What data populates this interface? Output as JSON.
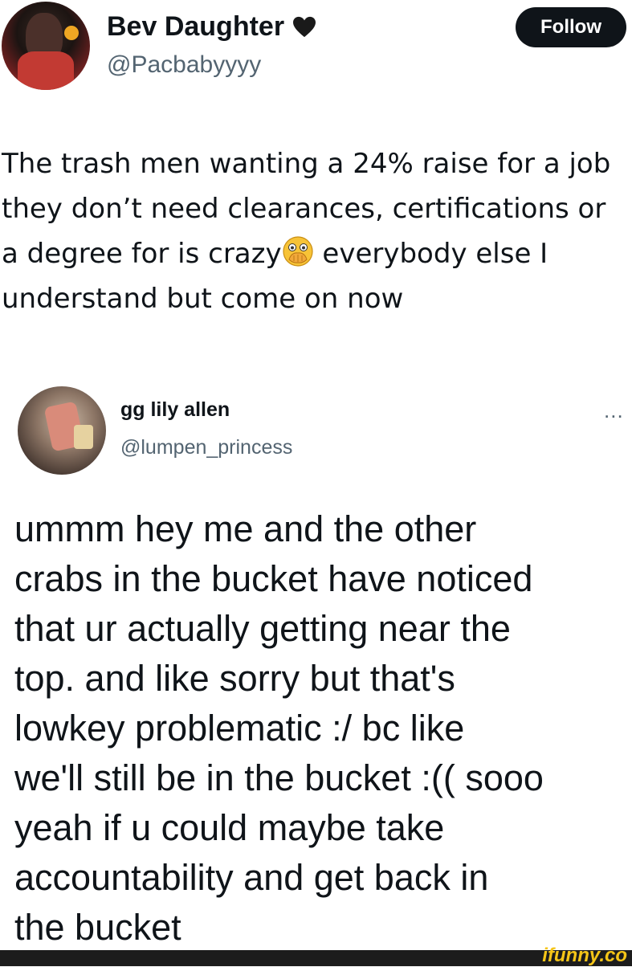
{
  "tweet1": {
    "display_name": "Bev Daughter",
    "verified_icon": "black-heart-icon",
    "handle": "@Pacbabyyyy",
    "follow_label": "Follow",
    "text_before_emoji": "The trash men wanting a 24% raise for a job they don’t need clearances, certifications or a degree for is crazy",
    "emoji": "face-with-open-eyes-and-hand-over-mouth-icon",
    "text_after_emoji": " everybody else I understand but come on now"
  },
  "tweet2": {
    "display_name": "gg lily allen",
    "handle": "@lumpen_princess",
    "more_label": "...",
    "lines": [
      "ummm hey me and the other",
      "crabs in the bucket have noticed",
      "that ur actually getting near the",
      "top. and like sorry but that's",
      "lowkey problematic :/ bc like",
      "we'll still be in the bucket :(( sooo",
      "yeah if u could maybe take",
      "accountability and get back in",
      "the bucket"
    ]
  },
  "watermark": "ifunny.co",
  "colors": {
    "text": "#0f1419",
    "secondary": "#536471",
    "follow_bg": "#0f1419",
    "brand": "#f5c518"
  }
}
